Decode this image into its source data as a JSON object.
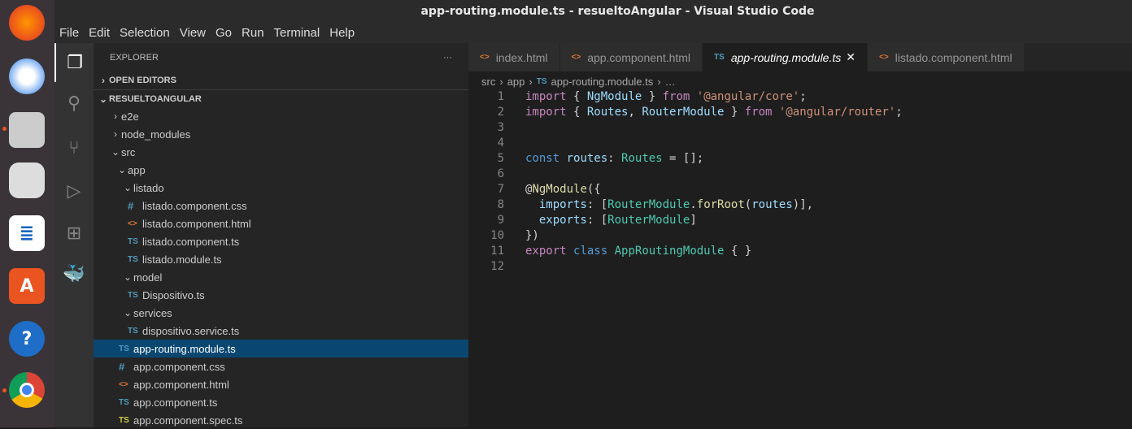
{
  "window": {
    "title": "app-routing.module.ts - resueltoAngular - Visual Studio Code"
  },
  "menu": [
    "File",
    "Edit",
    "Selection",
    "View",
    "Go",
    "Run",
    "Terminal",
    "Help"
  ],
  "explorer": {
    "title": "EXPLORER",
    "more": "···",
    "open_editors": "OPEN EDITORS",
    "project": "RESUELTOANGULAR",
    "tree": [
      {
        "label": "e2e",
        "type": "folder",
        "open": false,
        "depth": 0
      },
      {
        "label": "node_modules",
        "type": "folder",
        "open": false,
        "depth": 0
      },
      {
        "label": "src",
        "type": "folder",
        "open": true,
        "depth": 0
      },
      {
        "label": "app",
        "type": "folder",
        "open": true,
        "depth": 1
      },
      {
        "label": "listado",
        "type": "folder",
        "open": true,
        "depth": 2
      },
      {
        "label": "listado.component.css",
        "type": "css",
        "depth": 3
      },
      {
        "label": "listado.component.html",
        "type": "html",
        "depth": 3
      },
      {
        "label": "listado.component.ts",
        "type": "ts",
        "depth": 3
      },
      {
        "label": "listado.module.ts",
        "type": "ts",
        "depth": 3
      },
      {
        "label": "model",
        "type": "folder",
        "open": true,
        "depth": 2
      },
      {
        "label": "Dispositivo.ts",
        "type": "ts",
        "depth": 3
      },
      {
        "label": "services",
        "type": "folder",
        "open": true,
        "depth": 2
      },
      {
        "label": "dispositivo.service.ts",
        "type": "ts",
        "depth": 3
      },
      {
        "label": "app-routing.module.ts",
        "type": "ts",
        "depth": 2,
        "selected": true
      },
      {
        "label": "app.component.css",
        "type": "css",
        "depth": 2
      },
      {
        "label": "app.component.html",
        "type": "html",
        "depth": 2
      },
      {
        "label": "app.component.ts",
        "type": "ts",
        "depth": 2
      },
      {
        "label": "app.component.spec.ts",
        "type": "spec",
        "depth": 2
      }
    ]
  },
  "icon_glyphs": {
    "ts": "TS",
    "css": "#",
    "html": "<>",
    "spec": "TS"
  },
  "tabs": [
    {
      "label": "index.html",
      "type": "html"
    },
    {
      "label": "app.component.html",
      "type": "html"
    },
    {
      "label": "app-routing.module.ts",
      "type": "ts",
      "active": true,
      "close": "✕"
    },
    {
      "label": "listado.component.html",
      "type": "html"
    }
  ],
  "breadcrumb": [
    "src",
    "app",
    "app-routing.module.ts",
    "…"
  ],
  "code": [
    [
      [
        "kw",
        "import"
      ],
      [
        "pl",
        " { "
      ],
      [
        "var",
        "NgModule"
      ],
      [
        "pl",
        " } "
      ],
      [
        "kw",
        "from"
      ],
      [
        "pl",
        " "
      ],
      [
        "str",
        "'@angular/core'"
      ],
      [
        "pl",
        ";"
      ]
    ],
    [
      [
        "kw",
        "import"
      ],
      [
        "pl",
        " { "
      ],
      [
        "var",
        "Routes"
      ],
      [
        "pl",
        ", "
      ],
      [
        "var",
        "RouterModule"
      ],
      [
        "pl",
        " } "
      ],
      [
        "kw",
        "from"
      ],
      [
        "pl",
        " "
      ],
      [
        "str",
        "'@angular/router'"
      ],
      [
        "pl",
        ";"
      ]
    ],
    [],
    [],
    [
      [
        "bl",
        "const"
      ],
      [
        "pl",
        " "
      ],
      [
        "var",
        "routes"
      ],
      [
        "pl",
        ": "
      ],
      [
        "ty",
        "Routes"
      ],
      [
        "pl",
        " = [];"
      ]
    ],
    [],
    [
      [
        "pl",
        "@"
      ],
      [
        "fn",
        "NgModule"
      ],
      [
        "pl",
        "({"
      ]
    ],
    [
      [
        "pl",
        "  "
      ],
      [
        "var",
        "imports"
      ],
      [
        "pl",
        ": ["
      ],
      [
        "ty",
        "RouterModule"
      ],
      [
        "pl",
        "."
      ],
      [
        "fn",
        "forRoot"
      ],
      [
        "pl",
        "("
      ],
      [
        "var",
        "routes"
      ],
      [
        "pl",
        ")],"
      ]
    ],
    [
      [
        "pl",
        "  "
      ],
      [
        "var",
        "exports"
      ],
      [
        "pl",
        ": ["
      ],
      [
        "ty",
        "RouterModule"
      ],
      [
        "pl",
        "]"
      ]
    ],
    [
      [
        "pl",
        "})"
      ]
    ],
    [
      [
        "kw",
        "export"
      ],
      [
        "pl",
        " "
      ],
      [
        "bl",
        "class"
      ],
      [
        "pl",
        " "
      ],
      [
        "ty",
        "AppRoutingModule"
      ],
      [
        "pl",
        " { }"
      ]
    ],
    []
  ]
}
